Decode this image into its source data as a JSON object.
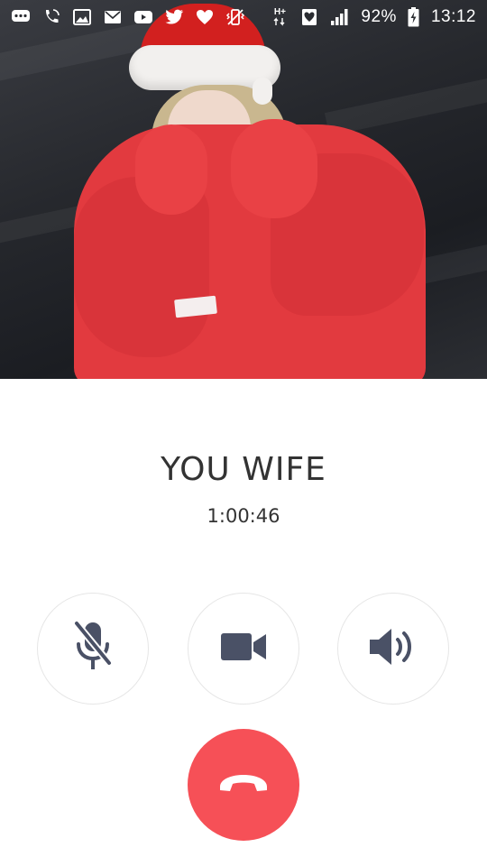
{
  "status_bar": {
    "battery_percent": "92%",
    "time": "13:12",
    "network": "H+",
    "left_icons": [
      "chat-bubble-icon",
      "phone-call-icon",
      "image-icon",
      "mail-icon",
      "youtube-icon",
      "twitter-icon",
      "heart-icon",
      "vibrate-icon"
    ],
    "right_icons": [
      "hplus-data-icon",
      "heart-box-icon",
      "signal-icon",
      "battery-charging-icon"
    ]
  },
  "caller": {
    "name": "YOU WIFE",
    "duration": "1:00:46"
  },
  "controls": {
    "mute_icon": "mic-off-icon",
    "video_icon": "video-camera-icon",
    "speaker_icon": "speaker-icon",
    "end_call_icon": "hang-up-icon",
    "end_call_color": "#f65057",
    "icon_color": "#4a5166"
  }
}
